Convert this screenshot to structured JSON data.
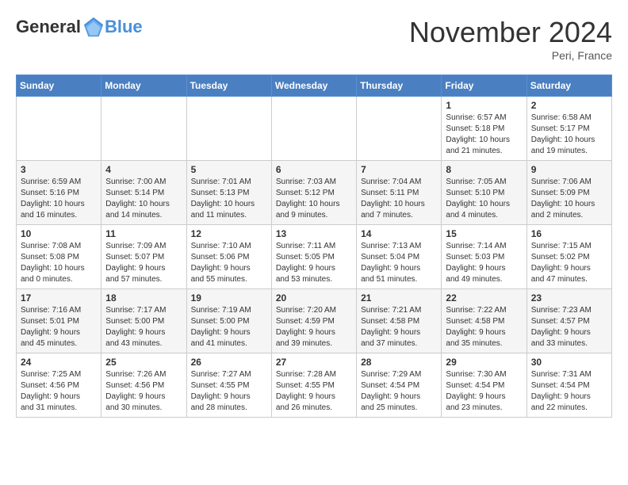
{
  "header": {
    "logo_general": "General",
    "logo_blue": "Blue",
    "month_title": "November 2024",
    "location": "Peri, France"
  },
  "days_of_week": [
    "Sunday",
    "Monday",
    "Tuesday",
    "Wednesday",
    "Thursday",
    "Friday",
    "Saturday"
  ],
  "weeks": [
    {
      "days": [
        {
          "num": "",
          "info": ""
        },
        {
          "num": "",
          "info": ""
        },
        {
          "num": "",
          "info": ""
        },
        {
          "num": "",
          "info": ""
        },
        {
          "num": "",
          "info": ""
        },
        {
          "num": "1",
          "info": "Sunrise: 6:57 AM\nSunset: 5:18 PM\nDaylight: 10 hours\nand 21 minutes."
        },
        {
          "num": "2",
          "info": "Sunrise: 6:58 AM\nSunset: 5:17 PM\nDaylight: 10 hours\nand 19 minutes."
        }
      ]
    },
    {
      "days": [
        {
          "num": "3",
          "info": "Sunrise: 6:59 AM\nSunset: 5:16 PM\nDaylight: 10 hours\nand 16 minutes."
        },
        {
          "num": "4",
          "info": "Sunrise: 7:00 AM\nSunset: 5:14 PM\nDaylight: 10 hours\nand 14 minutes."
        },
        {
          "num": "5",
          "info": "Sunrise: 7:01 AM\nSunset: 5:13 PM\nDaylight: 10 hours\nand 11 minutes."
        },
        {
          "num": "6",
          "info": "Sunrise: 7:03 AM\nSunset: 5:12 PM\nDaylight: 10 hours\nand 9 minutes."
        },
        {
          "num": "7",
          "info": "Sunrise: 7:04 AM\nSunset: 5:11 PM\nDaylight: 10 hours\nand 7 minutes."
        },
        {
          "num": "8",
          "info": "Sunrise: 7:05 AM\nSunset: 5:10 PM\nDaylight: 10 hours\nand 4 minutes."
        },
        {
          "num": "9",
          "info": "Sunrise: 7:06 AM\nSunset: 5:09 PM\nDaylight: 10 hours\nand 2 minutes."
        }
      ]
    },
    {
      "days": [
        {
          "num": "10",
          "info": "Sunrise: 7:08 AM\nSunset: 5:08 PM\nDaylight: 10 hours\nand 0 minutes."
        },
        {
          "num": "11",
          "info": "Sunrise: 7:09 AM\nSunset: 5:07 PM\nDaylight: 9 hours\nand 57 minutes."
        },
        {
          "num": "12",
          "info": "Sunrise: 7:10 AM\nSunset: 5:06 PM\nDaylight: 9 hours\nand 55 minutes."
        },
        {
          "num": "13",
          "info": "Sunrise: 7:11 AM\nSunset: 5:05 PM\nDaylight: 9 hours\nand 53 minutes."
        },
        {
          "num": "14",
          "info": "Sunrise: 7:13 AM\nSunset: 5:04 PM\nDaylight: 9 hours\nand 51 minutes."
        },
        {
          "num": "15",
          "info": "Sunrise: 7:14 AM\nSunset: 5:03 PM\nDaylight: 9 hours\nand 49 minutes."
        },
        {
          "num": "16",
          "info": "Sunrise: 7:15 AM\nSunset: 5:02 PM\nDaylight: 9 hours\nand 47 minutes."
        }
      ]
    },
    {
      "days": [
        {
          "num": "17",
          "info": "Sunrise: 7:16 AM\nSunset: 5:01 PM\nDaylight: 9 hours\nand 45 minutes."
        },
        {
          "num": "18",
          "info": "Sunrise: 7:17 AM\nSunset: 5:00 PM\nDaylight: 9 hours\nand 43 minutes."
        },
        {
          "num": "19",
          "info": "Sunrise: 7:19 AM\nSunset: 5:00 PM\nDaylight: 9 hours\nand 41 minutes."
        },
        {
          "num": "20",
          "info": "Sunrise: 7:20 AM\nSunset: 4:59 PM\nDaylight: 9 hours\nand 39 minutes."
        },
        {
          "num": "21",
          "info": "Sunrise: 7:21 AM\nSunset: 4:58 PM\nDaylight: 9 hours\nand 37 minutes."
        },
        {
          "num": "22",
          "info": "Sunrise: 7:22 AM\nSunset: 4:58 PM\nDaylight: 9 hours\nand 35 minutes."
        },
        {
          "num": "23",
          "info": "Sunrise: 7:23 AM\nSunset: 4:57 PM\nDaylight: 9 hours\nand 33 minutes."
        }
      ]
    },
    {
      "days": [
        {
          "num": "24",
          "info": "Sunrise: 7:25 AM\nSunset: 4:56 PM\nDaylight: 9 hours\nand 31 minutes."
        },
        {
          "num": "25",
          "info": "Sunrise: 7:26 AM\nSunset: 4:56 PM\nDaylight: 9 hours\nand 30 minutes."
        },
        {
          "num": "26",
          "info": "Sunrise: 7:27 AM\nSunset: 4:55 PM\nDaylight: 9 hours\nand 28 minutes."
        },
        {
          "num": "27",
          "info": "Sunrise: 7:28 AM\nSunset: 4:55 PM\nDaylight: 9 hours\nand 26 minutes."
        },
        {
          "num": "28",
          "info": "Sunrise: 7:29 AM\nSunset: 4:54 PM\nDaylight: 9 hours\nand 25 minutes."
        },
        {
          "num": "29",
          "info": "Sunrise: 7:30 AM\nSunset: 4:54 PM\nDaylight: 9 hours\nand 23 minutes."
        },
        {
          "num": "30",
          "info": "Sunrise: 7:31 AM\nSunset: 4:54 PM\nDaylight: 9 hours\nand 22 minutes."
        }
      ]
    }
  ]
}
